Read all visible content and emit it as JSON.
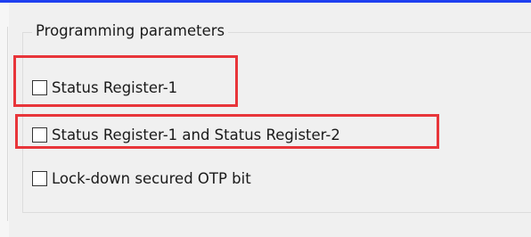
{
  "groupbox": {
    "title": "Programming parameters"
  },
  "options": [
    {
      "label": "Status Register-1",
      "checked": false
    },
    {
      "label": "Status Register-1 and Status Register-2",
      "checked": false
    },
    {
      "label": "Lock-down secured OTP bit",
      "checked": false
    }
  ],
  "colors": {
    "highlight": "#e8353a",
    "top_edge": "#1f3ff0",
    "background": "#f0f0f0"
  }
}
